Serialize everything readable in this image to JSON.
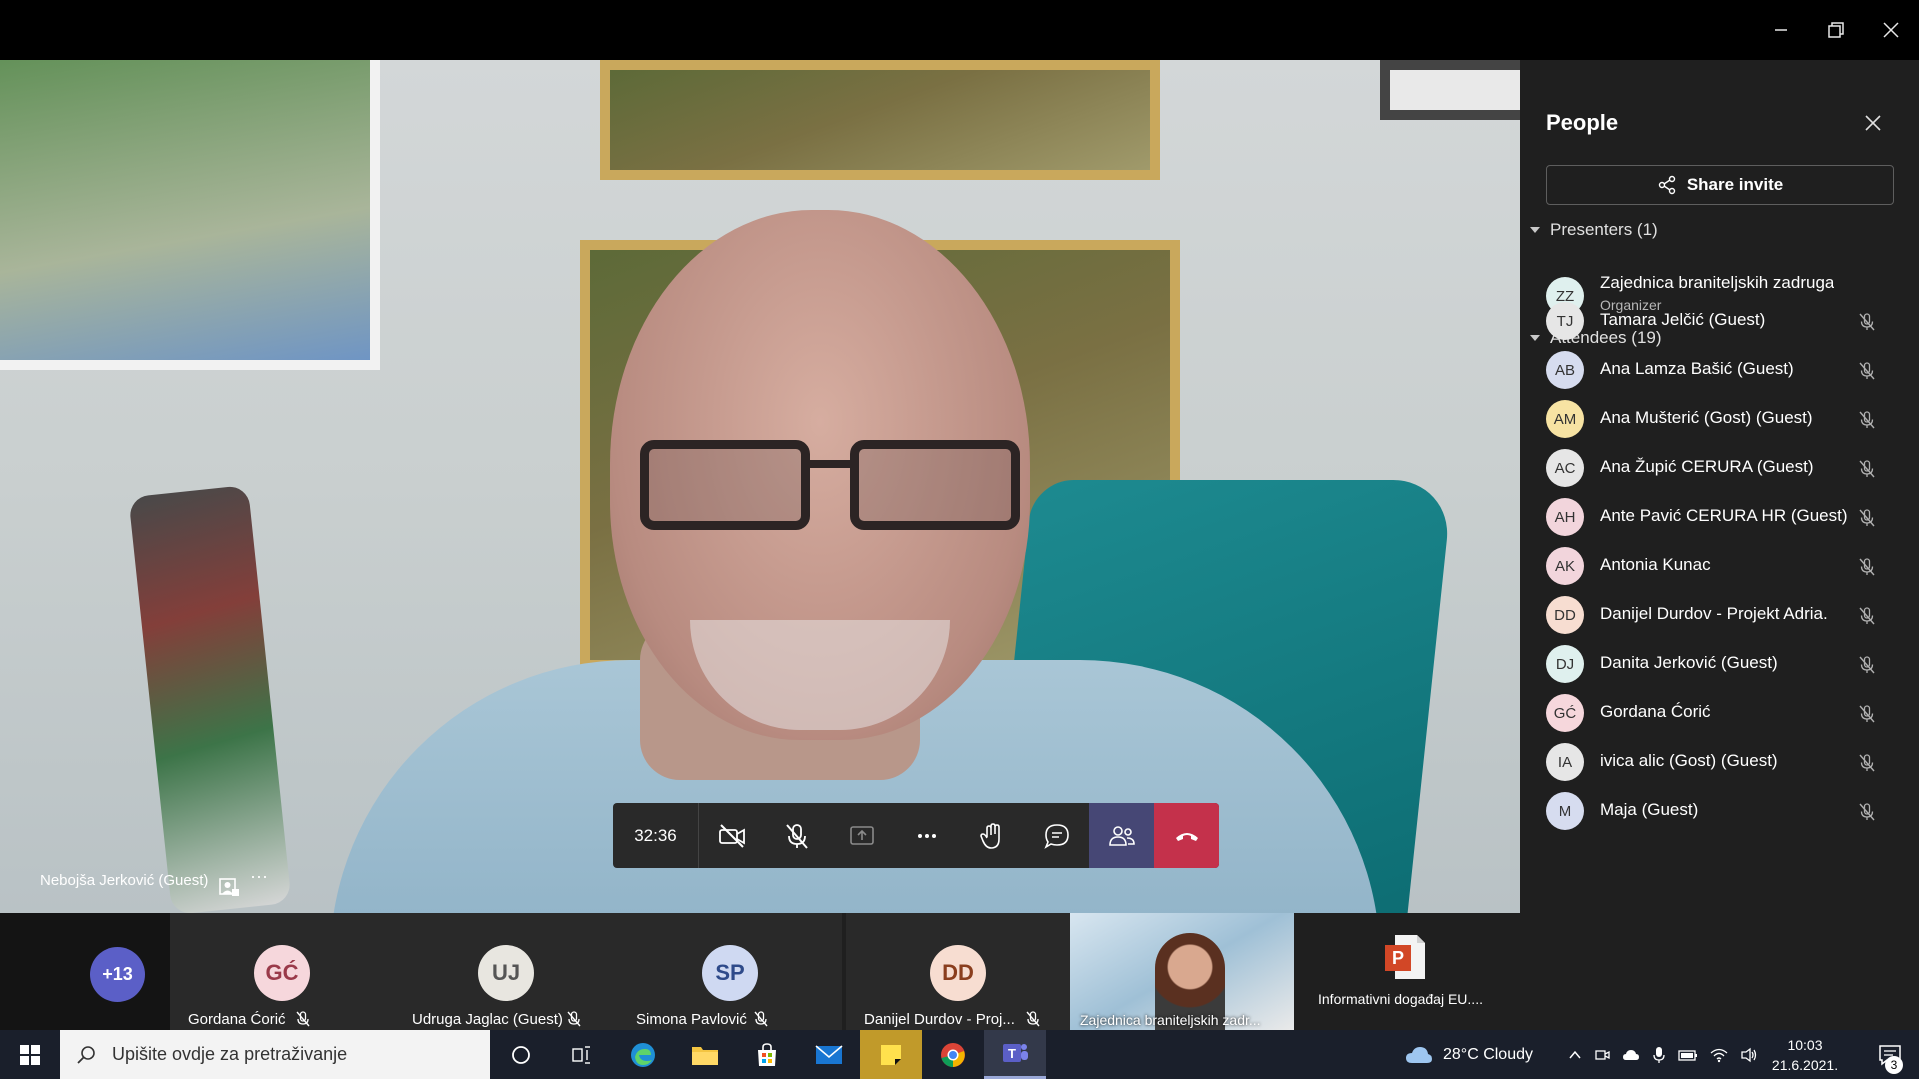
{
  "window": {
    "minimize_icon": "minimize-icon",
    "maximize_icon": "restore-icon",
    "close_icon": "close-icon"
  },
  "meeting": {
    "speaker_name": "Nebojša Jerković (Guest)",
    "timer": "32:36",
    "controls": [
      "camera-off-icon",
      "mic-off-icon",
      "share-screen-icon",
      "more-icon",
      "raise-hand-icon",
      "chat-icon",
      "people-icon",
      "hang-up-icon"
    ]
  },
  "strip": {
    "more_count": "+13",
    "tiles": [
      {
        "initials": "GĆ",
        "name": "Gordana Ćorić",
        "bg": "#f6d7dc",
        "fg": "#9a3a4a"
      },
      {
        "initials": "UJ",
        "name": "Udruga Jaglac (Guest)",
        "bg": "#e8e6e0",
        "fg": "#555"
      },
      {
        "initials": "SP",
        "name": "Simona Pavlović",
        "bg": "#cfd9f2",
        "fg": "#2e4a8a"
      },
      {
        "initials": "DD",
        "name": "Danijel Durdov - Proj...",
        "bg": "#f7ddd1",
        "fg": "#8a3e1e"
      }
    ],
    "share_name": "Zajednica braniteljskih zadr...",
    "presentation": "Informativni događaj EU...."
  },
  "people": {
    "title": "People",
    "share_invite": "Share invite",
    "presenters_label": "Presenters (1)",
    "organizer": {
      "initials": "ZZ",
      "name": "Zajednica braniteljskih zadruga",
      "role": "Organizer",
      "bg": "#dff0ee"
    },
    "attendees_label": "Attendees (19)",
    "attendees": [
      {
        "initials": "TJ",
        "name": "Tamara Jelčić (Guest)",
        "bg": "#e6e6e6"
      },
      {
        "initials": "AB",
        "name": "Ana Lamza Bašić (Guest)",
        "bg": "#d6dcef"
      },
      {
        "initials": "AM",
        "name": "Ana Mušterić (Gost) (Guest)",
        "bg": "#f7e3a3"
      },
      {
        "initials": "AC",
        "name": "Ana Župić CERURA (Guest)",
        "bg": "#e6e6e6"
      },
      {
        "initials": "AH",
        "name": "Ante Pavić CERURA HR (Guest)",
        "bg": "#f2d5dc"
      },
      {
        "initials": "AK",
        "name": "Antonia Kunac",
        "bg": "#f2d5dc"
      },
      {
        "initials": "DD",
        "name": "Danijel Durdov - Projekt Adria.",
        "bg": "#f7ddd1"
      },
      {
        "initials": "DJ",
        "name": "Danita Jerković (Guest)",
        "bg": "#dff0ee"
      },
      {
        "initials": "GĆ",
        "name": "Gordana Ćorić",
        "bg": "#f6d7dc"
      },
      {
        "initials": "IA",
        "name": "ivica alic (Gost) (Guest)",
        "bg": "#e6e6e6"
      },
      {
        "initials": "M",
        "name": "Maja (Guest)",
        "bg": "#d6dcef"
      }
    ]
  },
  "taskbar": {
    "search_placeholder": "Upišite ovdje za pretraživanje",
    "weather": "28°C  Cloudy",
    "time": "10:03",
    "date": "21.6.2021.",
    "notifications": "3"
  },
  "colors": {
    "accent": "#464775",
    "hangup": "#c4314b",
    "panel_bg": "#1f1f1f"
  }
}
